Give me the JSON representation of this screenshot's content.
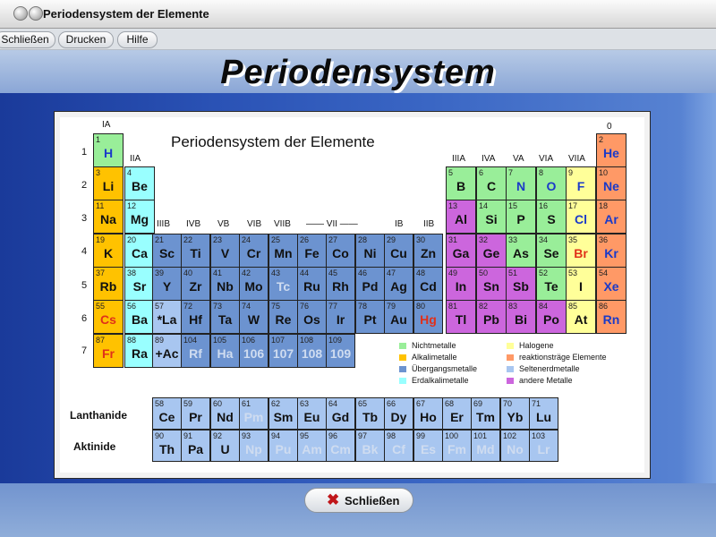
{
  "window": {
    "title": "Periodensystem der Elemente"
  },
  "menu": {
    "close": "Schließen",
    "print": "Drucken",
    "help": "Hilfe"
  },
  "header": {
    "title": "Periodensystem"
  },
  "table": {
    "title": "Periodensystem der Elemente",
    "periods": [
      "1",
      "2",
      "3",
      "4",
      "5",
      "6",
      "7"
    ],
    "groups": {
      "IA": "IA",
      "IIA": "IIA",
      "IIIB": "IIIB",
      "IVB": "IVB",
      "VB": "VB",
      "VIB": "VIB",
      "VIIB": "VIIB",
      "VIII": "—— VII ——",
      "IB": "IB",
      "IIB": "IIB",
      "IIIA": "IIIA",
      "IVA": "IVA",
      "VA": "VA",
      "VIA": "VIA",
      "VIIA": "VIIA",
      "zero": "0"
    },
    "colors": {
      "nm": "#99ee99",
      "al": "#ffc200",
      "ea": "#99ffff",
      "tm": "#6c93d0",
      "re": "#a8c6f0",
      "ha": "#ffff99",
      "ng": "#ff9966",
      "om": "#cc66dd",
      "red": "#e0301a",
      "blue": "#1b3ac8",
      "wht": "#ffffff"
    },
    "elements": [
      {
        "n": "1",
        "s": "H",
        "t": "nm",
        "p": 1,
        "g": 1,
        "c": "blue"
      },
      {
        "n": "2",
        "s": "He",
        "t": "ng",
        "p": 1,
        "g": 18,
        "c": "blue"
      },
      {
        "n": "3",
        "s": "Li",
        "t": "al",
        "p": 2,
        "g": 1
      },
      {
        "n": "4",
        "s": "Be",
        "t": "ea",
        "p": 2,
        "g": 2
      },
      {
        "n": "5",
        "s": "B",
        "t": "nm",
        "p": 2,
        "g": 13
      },
      {
        "n": "6",
        "s": "C",
        "t": "nm",
        "p": 2,
        "g": 14
      },
      {
        "n": "7",
        "s": "N",
        "t": "nm",
        "p": 2,
        "g": 15,
        "c": "blue"
      },
      {
        "n": "8",
        "s": "O",
        "t": "nm",
        "p": 2,
        "g": 16,
        "c": "blue"
      },
      {
        "n": "9",
        "s": "F",
        "t": "ha",
        "p": 2,
        "g": 17,
        "c": "blue"
      },
      {
        "n": "10",
        "s": "Ne",
        "t": "ng",
        "p": 2,
        "g": 18,
        "c": "blue"
      },
      {
        "n": "11",
        "s": "Na",
        "t": "al",
        "p": 3,
        "g": 1
      },
      {
        "n": "12",
        "s": "Mg",
        "t": "ea",
        "p": 3,
        "g": 2
      },
      {
        "n": "13",
        "s": "Al",
        "t": "om",
        "p": 3,
        "g": 13
      },
      {
        "n": "14",
        "s": "Si",
        "t": "nm",
        "p": 3,
        "g": 14
      },
      {
        "n": "15",
        "s": "P",
        "t": "nm",
        "p": 3,
        "g": 15
      },
      {
        "n": "16",
        "s": "S",
        "t": "nm",
        "p": 3,
        "g": 16
      },
      {
        "n": "17",
        "s": "Cl",
        "t": "ha",
        "p": 3,
        "g": 17,
        "c": "blue"
      },
      {
        "n": "18",
        "s": "Ar",
        "t": "ng",
        "p": 3,
        "g": 18,
        "c": "blue"
      },
      {
        "n": "19",
        "s": "K",
        "t": "al",
        "p": 4,
        "g": 1
      },
      {
        "n": "20",
        "s": "Ca",
        "t": "ea",
        "p": 4,
        "g": 2
      },
      {
        "n": "21",
        "s": "Sc",
        "t": "tm",
        "p": 4,
        "g": 3
      },
      {
        "n": "22",
        "s": "Ti",
        "t": "tm",
        "p": 4,
        "g": 4
      },
      {
        "n": "23",
        "s": "V",
        "t": "tm",
        "p": 4,
        "g": 5
      },
      {
        "n": "24",
        "s": "Cr",
        "t": "tm",
        "p": 4,
        "g": 6
      },
      {
        "n": "25",
        "s": "Mn",
        "t": "tm",
        "p": 4,
        "g": 7
      },
      {
        "n": "26",
        "s": "Fe",
        "t": "tm",
        "p": 4,
        "g": 8
      },
      {
        "n": "27",
        "s": "Co",
        "t": "tm",
        "p": 4,
        "g": 9
      },
      {
        "n": "28",
        "s": "Ni",
        "t": "tm",
        "p": 4,
        "g": 10
      },
      {
        "n": "29",
        "s": "Cu",
        "t": "tm",
        "p": 4,
        "g": 11
      },
      {
        "n": "30",
        "s": "Zn",
        "t": "tm",
        "p": 4,
        "g": 12
      },
      {
        "n": "31",
        "s": "Ga",
        "t": "om",
        "p": 4,
        "g": 13
      },
      {
        "n": "32",
        "s": "Ge",
        "t": "om",
        "p": 4,
        "g": 14
      },
      {
        "n": "33",
        "s": "As",
        "t": "nm",
        "p": 4,
        "g": 15
      },
      {
        "n": "34",
        "s": "Se",
        "t": "nm",
        "p": 4,
        "g": 16
      },
      {
        "n": "35",
        "s": "Br",
        "t": "ha",
        "p": 4,
        "g": 17,
        "c": "red"
      },
      {
        "n": "36",
        "s": "Kr",
        "t": "ng",
        "p": 4,
        "g": 18,
        "c": "blue"
      },
      {
        "n": "37",
        "s": "Rb",
        "t": "al",
        "p": 5,
        "g": 1
      },
      {
        "n": "38",
        "s": "Sr",
        "t": "ea",
        "p": 5,
        "g": 2
      },
      {
        "n": "39",
        "s": "Y",
        "t": "tm",
        "p": 5,
        "g": 3
      },
      {
        "n": "40",
        "s": "Zr",
        "t": "tm",
        "p": 5,
        "g": 4
      },
      {
        "n": "41",
        "s": "Nb",
        "t": "tm",
        "p": 5,
        "g": 5
      },
      {
        "n": "42",
        "s": "Mo",
        "t": "tm",
        "p": 5,
        "g": 6
      },
      {
        "n": "43",
        "s": "Tc",
        "t": "tm",
        "p": 5,
        "g": 7,
        "c": "wht"
      },
      {
        "n": "44",
        "s": "Ru",
        "t": "tm",
        "p": 5,
        "g": 8
      },
      {
        "n": "45",
        "s": "Rh",
        "t": "tm",
        "p": 5,
        "g": 9
      },
      {
        "n": "46",
        "s": "Pd",
        "t": "tm",
        "p": 5,
        "g": 10
      },
      {
        "n": "47",
        "s": "Ag",
        "t": "tm",
        "p": 5,
        "g": 11
      },
      {
        "n": "48",
        "s": "Cd",
        "t": "tm",
        "p": 5,
        "g": 12
      },
      {
        "n": "49",
        "s": "In",
        "t": "om",
        "p": 5,
        "g": 13
      },
      {
        "n": "50",
        "s": "Sn",
        "t": "om",
        "p": 5,
        "g": 14
      },
      {
        "n": "51",
        "s": "Sb",
        "t": "om",
        "p": 5,
        "g": 15
      },
      {
        "n": "52",
        "s": "Te",
        "t": "nm",
        "p": 5,
        "g": 16
      },
      {
        "n": "53",
        "s": "I",
        "t": "ha",
        "p": 5,
        "g": 17
      },
      {
        "n": "54",
        "s": "Xe",
        "t": "ng",
        "p": 5,
        "g": 18,
        "c": "blue"
      },
      {
        "n": "55",
        "s": "Cs",
        "t": "al",
        "p": 6,
        "g": 1,
        "c": "red"
      },
      {
        "n": "56",
        "s": "Ba",
        "t": "ea",
        "p": 6,
        "g": 2
      },
      {
        "n": "57",
        "s": "*La",
        "t": "re",
        "p": 6,
        "g": 3
      },
      {
        "n": "72",
        "s": "Hf",
        "t": "tm",
        "p": 6,
        "g": 4
      },
      {
        "n": "73",
        "s": "Ta",
        "t": "tm",
        "p": 6,
        "g": 5
      },
      {
        "n": "74",
        "s": "W",
        "t": "tm",
        "p": 6,
        "g": 6
      },
      {
        "n": "75",
        "s": "Re",
        "t": "tm",
        "p": 6,
        "g": 7
      },
      {
        "n": "76",
        "s": "Os",
        "t": "tm",
        "p": 6,
        "g": 8
      },
      {
        "n": "77",
        "s": "Ir",
        "t": "tm",
        "p": 6,
        "g": 9
      },
      {
        "n": "78",
        "s": "Pt",
        "t": "tm",
        "p": 6,
        "g": 10
      },
      {
        "n": "79",
        "s": "Au",
        "t": "tm",
        "p": 6,
        "g": 11
      },
      {
        "n": "80",
        "s": "Hg",
        "t": "tm",
        "p": 6,
        "g": 12,
        "c": "red"
      },
      {
        "n": "81",
        "s": "Tl",
        "t": "om",
        "p": 6,
        "g": 13
      },
      {
        "n": "82",
        "s": "Pb",
        "t": "om",
        "p": 6,
        "g": 14
      },
      {
        "n": "83",
        "s": "Bi",
        "t": "om",
        "p": 6,
        "g": 15
      },
      {
        "n": "84",
        "s": "Po",
        "t": "om",
        "p": 6,
        "g": 16
      },
      {
        "n": "85",
        "s": "At",
        "t": "ha",
        "p": 6,
        "g": 17
      },
      {
        "n": "86",
        "s": "Rn",
        "t": "ng",
        "p": 6,
        "g": 18,
        "c": "blue"
      },
      {
        "n": "87",
        "s": "Fr",
        "t": "al",
        "p": 7,
        "g": 1,
        "c": "red"
      },
      {
        "n": "88",
        "s": "Ra",
        "t": "ea",
        "p": 7,
        "g": 2
      },
      {
        "n": "89",
        "s": "+Ac",
        "t": "re",
        "p": 7,
        "g": 3
      },
      {
        "n": "104",
        "s": "Rf",
        "t": "tm",
        "p": 7,
        "g": 4,
        "c": "wht"
      },
      {
        "n": "105",
        "s": "Ha",
        "t": "tm",
        "p": 7,
        "g": 5,
        "c": "wht"
      },
      {
        "n": "106",
        "s": "106",
        "t": "tm",
        "p": 7,
        "g": 6,
        "c": "wht"
      },
      {
        "n": "107",
        "s": "107",
        "t": "tm",
        "p": 7,
        "g": 7,
        "c": "wht"
      },
      {
        "n": "108",
        "s": "108",
        "t": "tm",
        "p": 7,
        "g": 8,
        "c": "wht"
      },
      {
        "n": "109",
        "s": "109",
        "t": "tm",
        "p": 7,
        "g": 9,
        "c": "wht"
      }
    ],
    "series": [
      {
        "label": "Lanthanide",
        "elements": [
          {
            "n": "58",
            "s": "Ce"
          },
          {
            "n": "59",
            "s": "Pr"
          },
          {
            "n": "60",
            "s": "Nd"
          },
          {
            "n": "61",
            "s": "Pm",
            "c": "wht"
          },
          {
            "n": "62",
            "s": "Sm"
          },
          {
            "n": "63",
            "s": "Eu"
          },
          {
            "n": "64",
            "s": "Gd"
          },
          {
            "n": "65",
            "s": "Tb"
          },
          {
            "n": "66",
            "s": "Dy"
          },
          {
            "n": "67",
            "s": "Ho"
          },
          {
            "n": "68",
            "s": "Er"
          },
          {
            "n": "69",
            "s": "Tm"
          },
          {
            "n": "70",
            "s": "Yb"
          },
          {
            "n": "71",
            "s": "Lu"
          }
        ]
      },
      {
        "label": "Aktinide",
        "elements": [
          {
            "n": "90",
            "s": "Th"
          },
          {
            "n": "91",
            "s": "Pa"
          },
          {
            "n": "92",
            "s": "U"
          },
          {
            "n": "93",
            "s": "Np",
            "c": "wht"
          },
          {
            "n": "94",
            "s": "Pu",
            "c": "wht"
          },
          {
            "n": "95",
            "s": "Am",
            "c": "wht"
          },
          {
            "n": "96",
            "s": "Cm",
            "c": "wht"
          },
          {
            "n": "97",
            "s": "Bk",
            "c": "wht"
          },
          {
            "n": "98",
            "s": "Cf",
            "c": "wht"
          },
          {
            "n": "99",
            "s": "Es",
            "c": "wht"
          },
          {
            "n": "100",
            "s": "Fm",
            "c": "wht"
          },
          {
            "n": "101",
            "s": "Md",
            "c": "wht"
          },
          {
            "n": "102",
            "s": "No",
            "c": "wht"
          },
          {
            "n": "103",
            "s": "Lr",
            "c": "wht"
          }
        ]
      }
    ],
    "legend": [
      {
        "label": "Nichtmetalle",
        "t": "nm"
      },
      {
        "label": "Halogene",
        "t": "ha"
      },
      {
        "label": "Alkalimetalle",
        "t": "al"
      },
      {
        "label": "reaktionsträge Elemente",
        "t": "ng"
      },
      {
        "label": "Übergangsmetalle",
        "t": "tm"
      },
      {
        "label": "Seltenerdmetalle",
        "t": "re"
      },
      {
        "label": "Erdalkalimetalle",
        "t": "ea"
      },
      {
        "label": "andere Metalle",
        "t": "om"
      }
    ]
  },
  "footer": {
    "close_label": "Schließen"
  }
}
